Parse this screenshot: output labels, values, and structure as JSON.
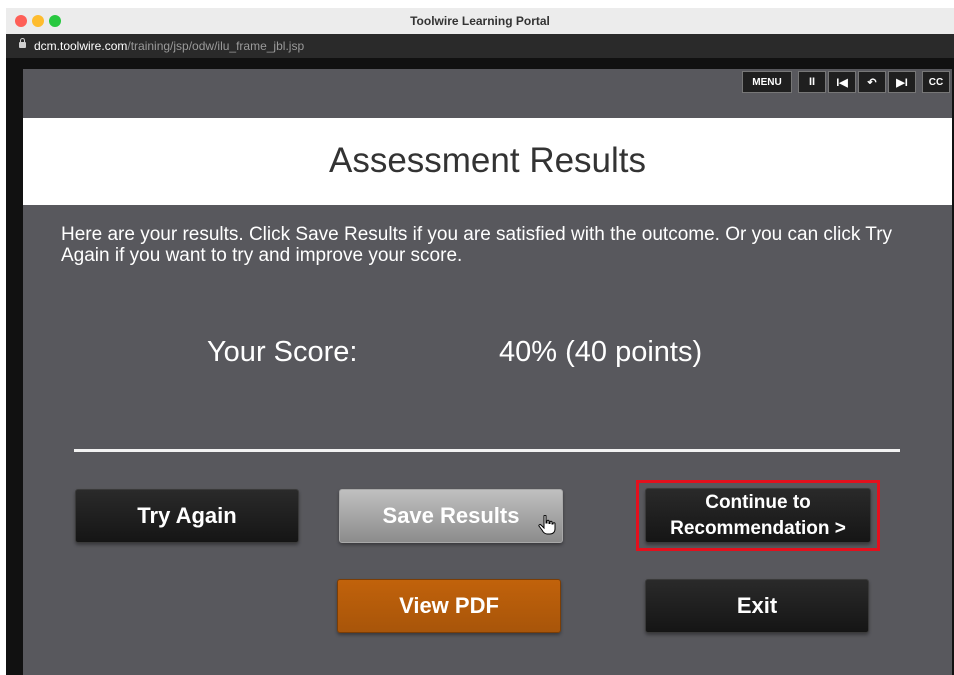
{
  "window": {
    "title": "Toolwire Learning Portal",
    "url_host": "dcm.toolwire.com",
    "url_path": "/training/jsp/odw/ilu_frame_jbl.jsp"
  },
  "player_controls": {
    "menu": "MENU",
    "pause": "II",
    "restart": "I◀",
    "replay": "↶",
    "next": "▶I",
    "cc": "CC"
  },
  "page": {
    "title": "Assessment Results",
    "instructions": "Here are your results. Click Save Results if you are satisfied with the outcome. Or you can click Try Again if you want to try and improve your score.",
    "score_label": "Your Score:",
    "score_value": "40% (40 points)"
  },
  "buttons": {
    "try_again": "Try Again",
    "save_results": "Save Results",
    "continue": "Continue to Recommendation >",
    "view_pdf": "View PDF",
    "exit": "Exit"
  },
  "colors": {
    "stage_bg": "#58585d",
    "highlight": "#e3101d",
    "pdf_button": "#b25a0a"
  }
}
